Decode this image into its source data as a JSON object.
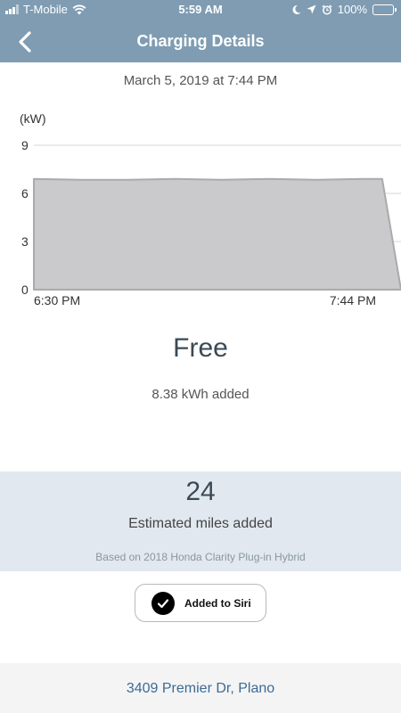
{
  "status_bar": {
    "carrier": "T-Mobile",
    "time": "5:59 AM",
    "battery": "100%"
  },
  "nav": {
    "title": "Charging Details"
  },
  "session": {
    "datetime": "March 5, 2019 at 7:44 PM",
    "cost": "Free",
    "energy": "8.38 kWh added"
  },
  "chart_data": {
    "type": "area",
    "ylabel": "(kW)",
    "ylim": [
      0,
      9
    ],
    "yticks": [
      "0",
      "3",
      "6",
      "9"
    ],
    "x_labels": [
      "6:30 PM",
      "7:44 PM"
    ],
    "points": [
      {
        "t": "6:30 PM",
        "kw": 0
      },
      {
        "t": "6:30 PM",
        "kw": 6.9
      },
      {
        "t": "6:40 PM",
        "kw": 6.85
      },
      {
        "t": "6:50 PM",
        "kw": 6.85
      },
      {
        "t": "7:00 PM",
        "kw": 6.9
      },
      {
        "t": "7:10 PM",
        "kw": 6.85
      },
      {
        "t": "7:20 PM",
        "kw": 6.9
      },
      {
        "t": "7:30 PM",
        "kw": 6.85
      },
      {
        "t": "7:40 PM",
        "kw": 6.9
      },
      {
        "t": "7:44 PM",
        "kw": 6.9
      },
      {
        "t": "7:48 PM",
        "kw": 0
      }
    ],
    "grid": true,
    "fill_color": "#cac9cc",
    "line_color": "#aaaaaa"
  },
  "miles": {
    "value": "24",
    "label": "Estimated miles added",
    "basis": "Based on 2018 Honda Clarity Plug-in Hybrid"
  },
  "siri": {
    "label": "Added to Siri"
  },
  "location": {
    "address": "3409 Premier Dr, Plano"
  },
  "colors": {
    "header": "#7f9cb2",
    "panel": "#e1e8f0",
    "link": "#3d6b93"
  }
}
